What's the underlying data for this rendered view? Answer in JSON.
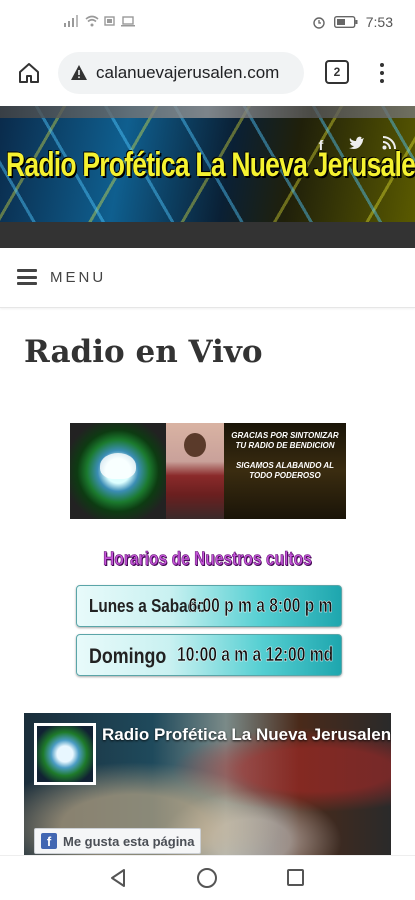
{
  "status_bar": {
    "time": "7:53",
    "icons": [
      "signal-icon",
      "wifi-icon",
      "usb-icon",
      "laptop-icon",
      "alarm-icon",
      "battery-icon"
    ]
  },
  "browser": {
    "url": "calanuevajerusalen.com",
    "tab_count": "2",
    "icons": [
      "home-icon",
      "info-icon",
      "more-vert-icon"
    ]
  },
  "header": {
    "site_title": "Radio Profética La Nueva Jerusalen",
    "social_icons": [
      "facebook-icon",
      "twitter-icon",
      "rss-icon"
    ]
  },
  "menu": {
    "label": "MENU"
  },
  "main": {
    "page_title": "Radio en Vivo",
    "promo": {
      "lines": [
        "GRACIAS POR SINTONIZAR TU RADIO DE BENDICION",
        "SIGAMOS ALABANDO AL TODO PODEROSO"
      ]
    },
    "schedule": {
      "title": "Horarios de Nuestros cultos",
      "rows": [
        {
          "day": "Lunes a Sabado",
          "time": "6:00 p m a 8:00 p m"
        },
        {
          "day": "Domingo",
          "time": "10:00 a m a 12:00 md"
        }
      ]
    },
    "facebook": {
      "page_name": "Radio Profética La Nueva Jerusalen",
      "like_button": "Me gusta esta página"
    }
  },
  "colors": {
    "banner_title": "#f5f230",
    "schedule_title": "#c455d8",
    "facebook_blue": "#4267b2",
    "nav_dark": "#333333"
  }
}
